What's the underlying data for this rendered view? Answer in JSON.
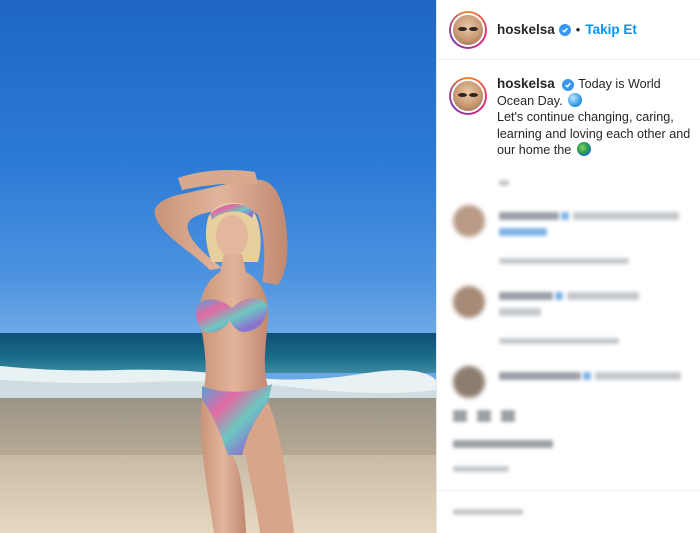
{
  "post": {
    "username": "hoskelsa",
    "follow_label": "Takip Et",
    "separator": "•"
  },
  "caption": {
    "username": "hoskelsa",
    "line1": "Today is World Ocean Day.",
    "line2": "Let's continue changing, caring, learning and loving each other and our home the"
  },
  "colors": {
    "follow": "#0095f6",
    "verified": "#3897f0",
    "text": "#262626"
  }
}
